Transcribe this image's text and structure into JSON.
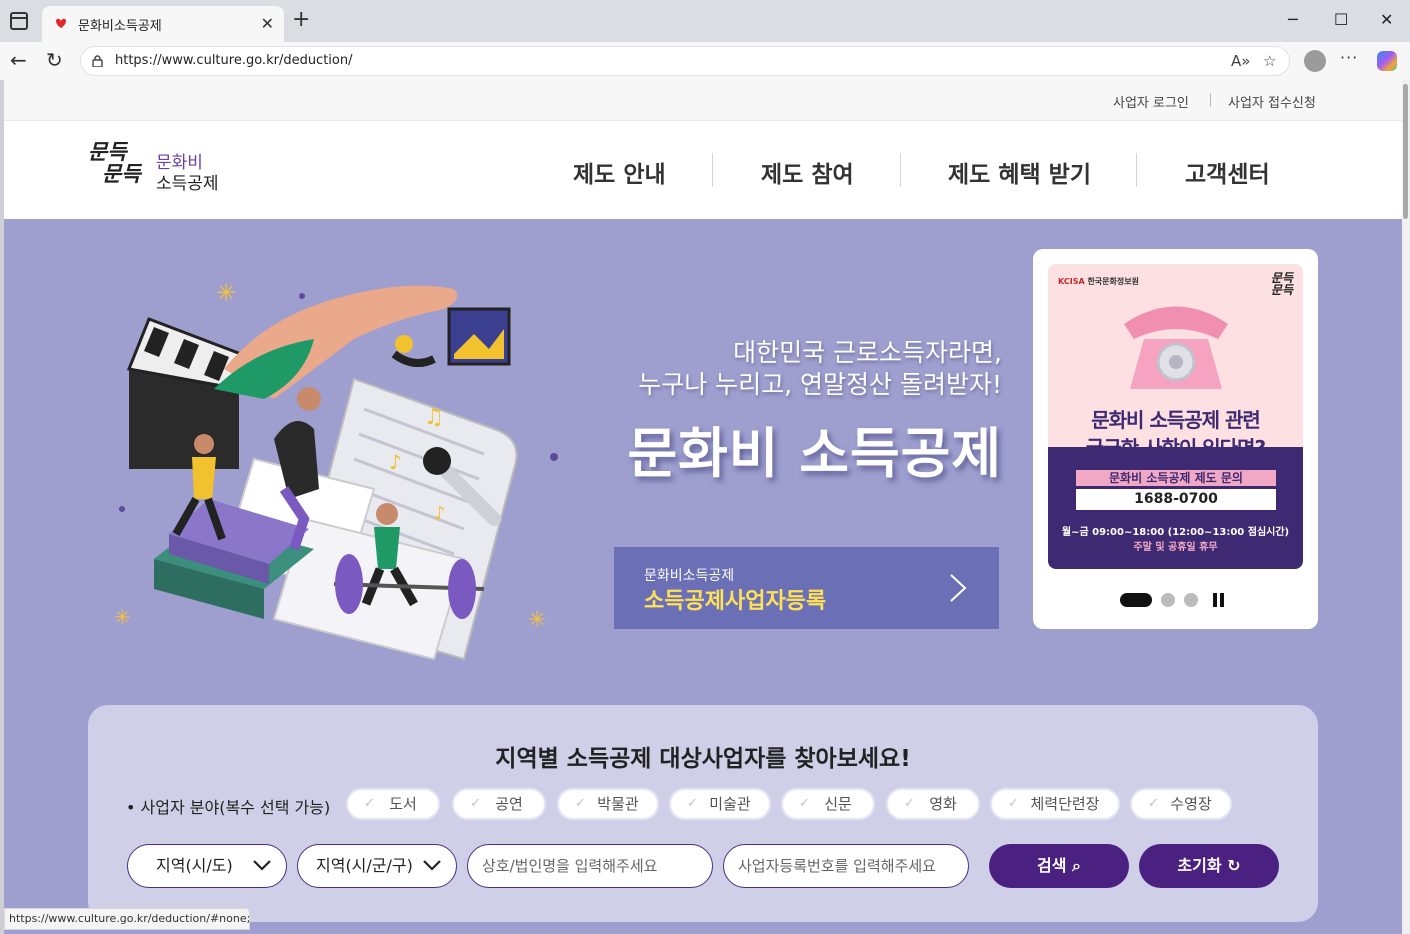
{
  "browser": {
    "tab_title": "문화비소득공제",
    "url": "https://www.culture.go.kr/deduction/",
    "status_url": "https://www.culture.go.kr/deduction/#none;"
  },
  "util_links": [
    "사업자 로그인",
    "사업자 접수신청"
  ],
  "logo": {
    "mark_line1": "문득",
    "mark_line2": "문득",
    "line1": "문화비",
    "line2": "소득공제"
  },
  "nav": [
    "제도 안내",
    "제도 참여",
    "제도 혜택 받기",
    "고객센터"
  ],
  "hero": {
    "subline1": "대한민국 근로소득자라면,",
    "subline2": "누구나 누리고, 연말정산 돌려받자!",
    "title": "문화비 소득공제",
    "register_small": "문화비소득공제",
    "register_big": "소득공제사업자등록"
  },
  "banner": {
    "org": "KCISA",
    "org_name": "한국문화정보원",
    "logo_line1": "문득",
    "logo_line2": "문득",
    "headline1": "문화비 소득공제 관련",
    "headline2": "궁금한 사항이 있다면?",
    "label": "문화비 소득공제 제도 문의",
    "phone": "1688-0700",
    "hours": "월~금 09:00~18:00 (12:00~13:00 점심시간)",
    "holiday": "주말 및 공휴일 휴무",
    "slide_count": 3,
    "active_slide": 1
  },
  "search": {
    "title": "지역별 소득공제 대상사업자를 찾아보세요!",
    "field_label": "• 사업자 분야(복수 선택 가능)",
    "categories": [
      "도서",
      "공연",
      "박물관",
      "미술관",
      "신문",
      "영화",
      "체력단련장",
      "수영장"
    ],
    "select_city": "지역(시/도)",
    "select_district": "지역(시/군/구)",
    "name_placeholder": "상호/법인명을 입력해주세요",
    "bizno_placeholder": "사업자등록번호를 입력해주세요",
    "search_label": "검색",
    "reset_label": "초기화"
  },
  "colors": {
    "hero_bg": "#9e9fcf",
    "brand_purple": "#4a2080",
    "register_btn": "#6b6fb6",
    "register_highlight": "#ffe155"
  }
}
